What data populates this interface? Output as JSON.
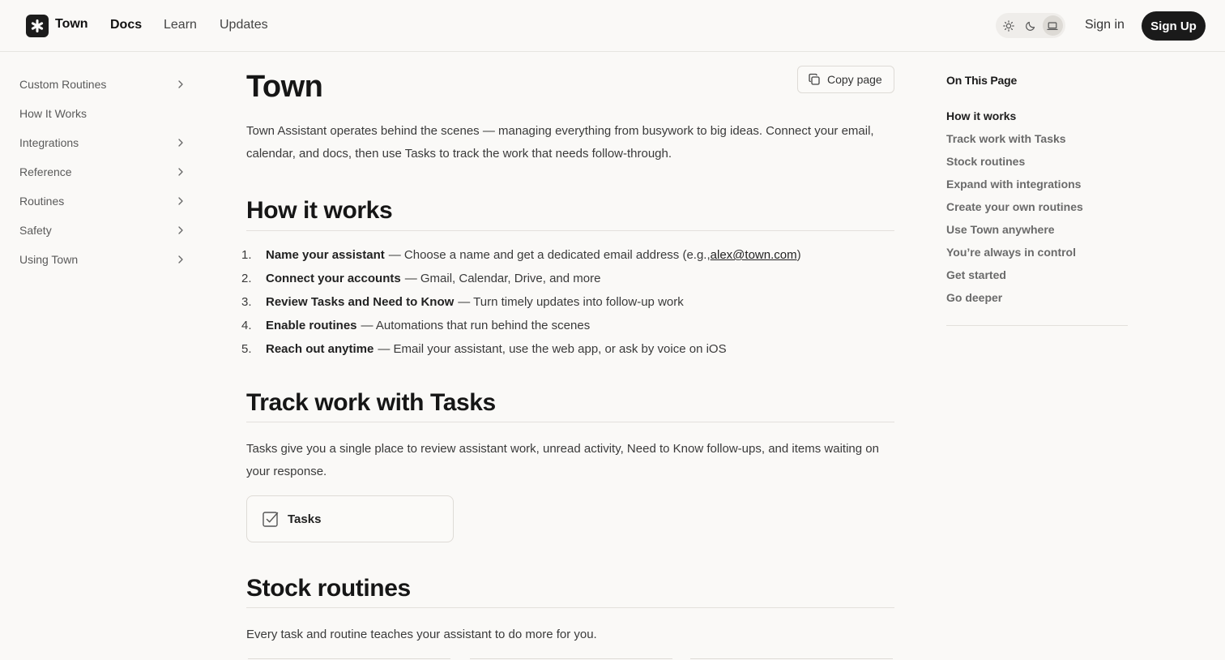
{
  "header": {
    "brand": "Town",
    "nav": [
      "Docs",
      "Learn",
      "Updates"
    ],
    "active_nav": "Docs",
    "theme_options": [
      "sun-icon",
      "moon-icon",
      "laptop-icon"
    ],
    "selected_theme": "laptop-icon",
    "signin_label": "Sign in",
    "signup_label": "Sign Up"
  },
  "sidebar": {
    "items": [
      {
        "label": "Custom Routines",
        "chevron": true
      },
      {
        "label": "How It Works",
        "chevron": false
      },
      {
        "label": "Integrations",
        "chevron": true
      },
      {
        "label": "Reference",
        "chevron": true
      },
      {
        "label": "Routines",
        "chevron": true
      },
      {
        "label": "Safety",
        "chevron": true
      },
      {
        "label": "Using Town",
        "chevron": true
      }
    ]
  },
  "main": {
    "copy_label": "Copy page",
    "title": "Town",
    "intro": "Town Assistant operates behind the scenes — managing everything from busywork to big ideas. Connect your email, calendar, and docs, then use Tasks to track the work that needs follow-through.",
    "section1": {
      "heading": "How it works",
      "steps": [
        {
          "num": "1.",
          "bold": "Name your assistant",
          "text": "— Choose a name and get a dedicated email address (e.g., ",
          "link": "alex@town.com",
          "after": ")"
        },
        {
          "num": "2.",
          "bold": "Connect your accounts",
          "text": "— Gmail, Calendar, Drive, and more",
          "link": "",
          "after": ""
        },
        {
          "num": "3.",
          "bold": "Review Tasks and Need to Know",
          "text": "— Turn timely updates into follow-up work",
          "link": "",
          "after": ""
        },
        {
          "num": "4.",
          "bold": "Enable routines",
          "text": "— Automations that run behind the scenes",
          "link": "",
          "after": ""
        },
        {
          "num": "5.",
          "bold": "Reach out anytime",
          "text": "— Email your assistant, use the web app, or ask by voice on iOS",
          "link": "",
          "after": ""
        }
      ]
    },
    "section2": {
      "heading": "Track work with Tasks",
      "body": "Tasks give you a single place to review assistant work, unread activity, Need to Know follow-ups, and items waiting on your response.",
      "card_label": "Tasks"
    },
    "section3": {
      "heading": "Stock routines",
      "body": "Every task and routine teaches your assistant to do more for you."
    }
  },
  "toc": {
    "title": "On This Page",
    "items": [
      "How it works",
      "Track work with Tasks",
      "Stock routines",
      "Expand with integrations",
      "Create your own routines",
      "Use Town anywhere",
      "You’re always in control",
      "Get started",
      "Go deeper"
    ],
    "active_index": 0
  }
}
